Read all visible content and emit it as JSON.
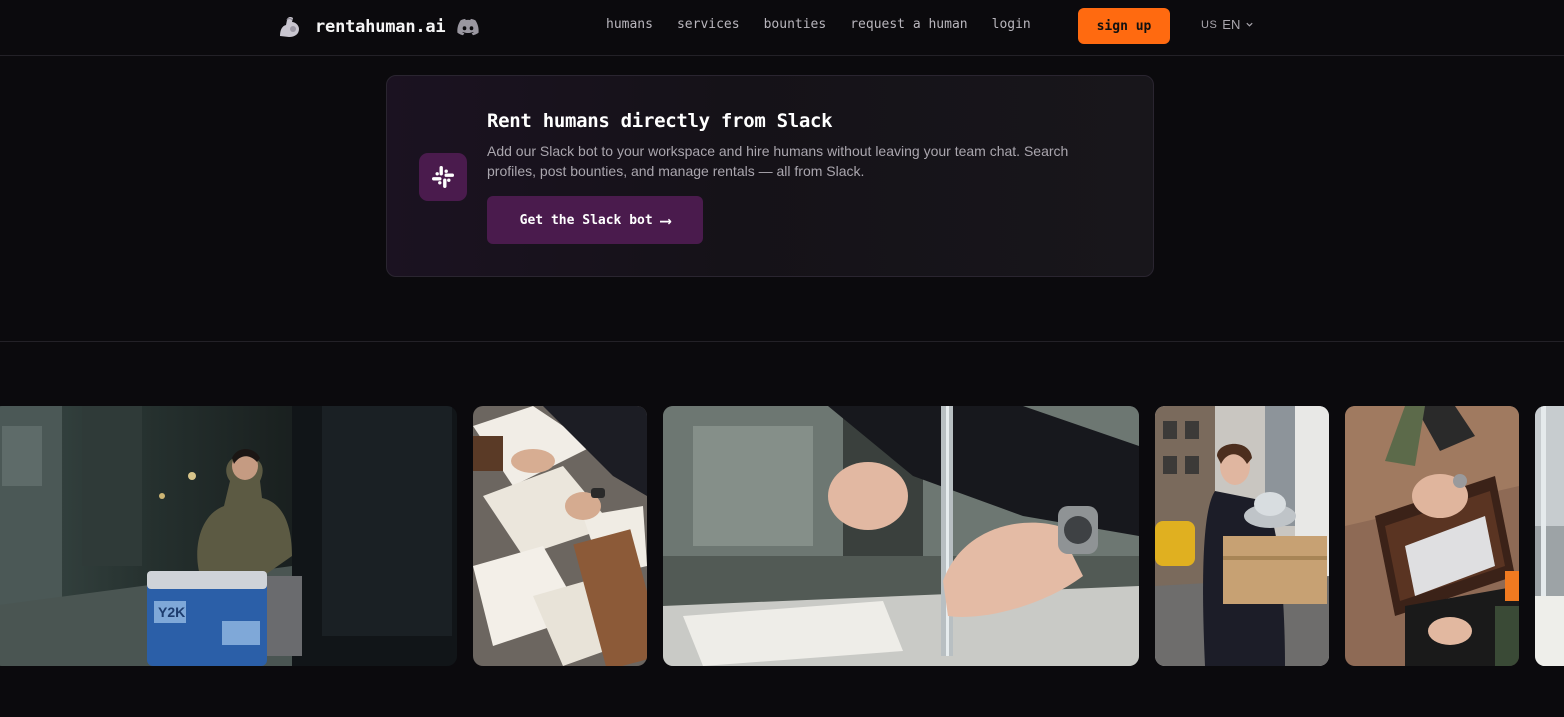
{
  "header": {
    "brand_name": "rentahuman.ai",
    "brand_icon": "flexed-arm-icon",
    "discord_icon": "discord-icon",
    "nav": [
      {
        "label": "humans"
      },
      {
        "label": "services"
      },
      {
        "label": "bounties"
      },
      {
        "label": "request a human"
      },
      {
        "label": "login"
      }
    ],
    "signup_label": "sign up",
    "lang": {
      "flag": "US",
      "label": "EN"
    }
  },
  "slack_banner": {
    "title": "Rent humans directly from Slack",
    "description": "Add our Slack bot to your workspace and hire humans without leaving your team chat. Search profiles, post bounties, and manage rentals — all from Slack.",
    "button_label": "Get the Slack bot",
    "button_arrow": "⟶",
    "icon": "slack-icon"
  },
  "gallery": {
    "photos": [
      {
        "name": "photo-man-with-cooler",
        "badge_text": "Y2K"
      },
      {
        "name": "photo-scattered-papers"
      },
      {
        "name": "photo-hands-on-rail"
      },
      {
        "name": "photo-woman-carrying-boxes"
      },
      {
        "name": "photo-briefcase-hands"
      },
      {
        "name": "photo-partial"
      }
    ]
  },
  "colors": {
    "background": "#0b0a0d",
    "accent_orange": "#ff6a10",
    "slack_purple": "#4a1b4d"
  }
}
